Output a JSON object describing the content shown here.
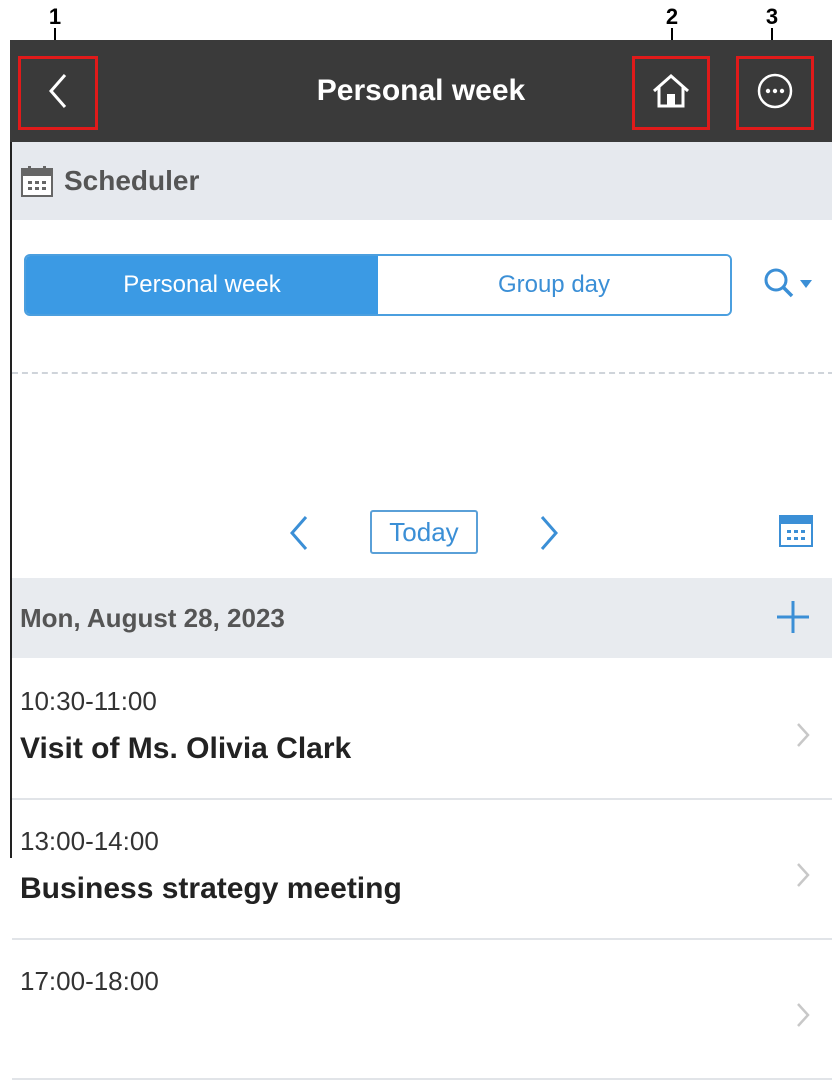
{
  "callouts": [
    "1",
    "2",
    "3"
  ],
  "topbar": {
    "title": "Personal week"
  },
  "app": {
    "name": "Scheduler"
  },
  "view_switch": {
    "active": "Personal week",
    "inactive": "Group day"
  },
  "nav": {
    "today_label": "Today"
  },
  "day": {
    "date_label": "Mon, August 28, 2023",
    "events": [
      {
        "time": "10:30-11:00",
        "title": "Visit of Ms. Olivia Clark"
      },
      {
        "time": "13:00-14:00",
        "title": "Business strategy meeting"
      },
      {
        "time": "17:00-18:00",
        "title": ""
      }
    ]
  },
  "colors": {
    "accent": "#3b9ae4",
    "topbar": "#3a3a3a",
    "callout_box": "#e01a1a"
  },
  "icons": [
    "back-chevron-icon",
    "home-icon",
    "more-options-icon",
    "calendar-icon",
    "search-icon",
    "chevron-down-icon",
    "prev-icon",
    "next-icon",
    "add-icon",
    "chevron-right-icon"
  ]
}
